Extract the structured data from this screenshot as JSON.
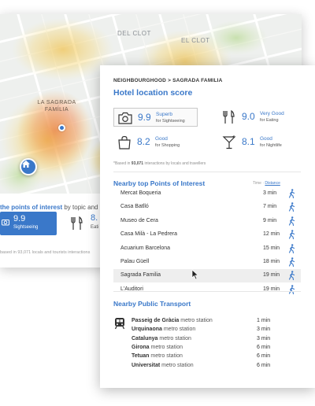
{
  "back_card": {
    "map": {
      "labels": [
        "DEL CLOT",
        "EL CLOT",
        "LA SAGRADA FAMÍLIA"
      ]
    },
    "heading_bold": "the points of interest",
    "heading_rest": " by topic and sho",
    "score_tile": {
      "value": "9.9",
      "label": "Sightseeing",
      "icon": "camera-icon"
    },
    "eating": {
      "value": "8.",
      "label": "Eati",
      "icon": "fork-knife-icon"
    },
    "note": "based in 93,071 locals and tourists interactions"
  },
  "front_card": {
    "breadcrumb": "NEIGHBOURGHOOD > SAGRADA FAMILIA",
    "title": "Hotel location score",
    "scores": [
      {
        "icon": "camera-icon",
        "value": "9.9",
        "label": "Superb",
        "sub": "for Sightseeing",
        "selected": true
      },
      {
        "icon": "fork-knife-icon",
        "value": "9.0",
        "label": "Very Good",
        "sub": "for Eating",
        "selected": false
      },
      {
        "icon": "shopping-bag-icon",
        "value": "8.2",
        "label": "Good",
        "sub": "for Shopping",
        "selected": false
      },
      {
        "icon": "cocktail-icon",
        "value": "8.1",
        "label": "Good",
        "sub": "for Nightlife",
        "selected": false
      }
    ],
    "based_prefix": "*Based in ",
    "based_count": "93,071",
    "based_suffix": " interactions by locals and travellers",
    "poi": {
      "title": "Nearby top Points of Interest",
      "sort_time": "Time",
      "sort_sep": " · ",
      "sort_distance": "Distance",
      "items": [
        {
          "name": "Mercat Boqueria",
          "time": "3 min"
        },
        {
          "name": "Casa Batlló",
          "time": "7 min"
        },
        {
          "name": "Museo de Cera",
          "time": "9 min"
        },
        {
          "name": "Casa Milà - La Pedrera",
          "time": "12 min"
        },
        {
          "name": "Acuarium Barcelona",
          "time": "15 min"
        },
        {
          "name": "Palau Güell",
          "time": "18 min"
        },
        {
          "name": "Sagrada Familia",
          "time": "19 min"
        },
        {
          "name": "L'Auditori",
          "time": "19 min"
        }
      ]
    },
    "transport": {
      "title": "Nearby Public Transport",
      "icon": "metro-train-icon",
      "items": [
        {
          "name": "Passeig de Gràcia",
          "kind": "metro station",
          "time": "1 min"
        },
        {
          "name": "Urquinaona",
          "kind": "metro station",
          "time": "3 min"
        },
        {
          "name": "Catalunya",
          "kind": "metro station",
          "time": "3 min"
        },
        {
          "name": "Girona",
          "kind": "metro station",
          "time": "6 min"
        },
        {
          "name": "Tetuan",
          "kind": "metro station",
          "time": "6 min"
        },
        {
          "name": "Universitat",
          "kind": "metro station",
          "time": "6 min"
        }
      ]
    }
  },
  "colors": {
    "accent": "#3a78c9",
    "heat": "#e5484d",
    "heat_warm": "#f2b84b"
  }
}
